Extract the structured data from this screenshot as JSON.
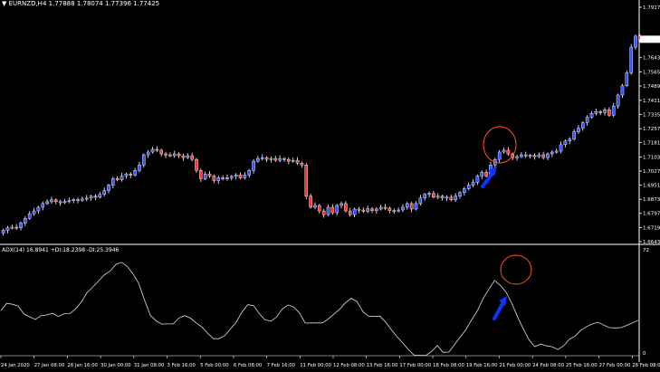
{
  "window": {
    "symbol_label": "EURNZD,H4",
    "ohlc": "1.77888 1.78074 1.77396 1.77425",
    "indicator_label": "ADX(14) 16.8941 +DI:18.2398 -DI:25.3946"
  },
  "colors": {
    "background": "#000000",
    "bull": "#3355ff",
    "bear": "#ff3333",
    "wick": "#ffffff",
    "axis": "#ffffff",
    "annotation_circle": "#ff5522",
    "arrow": "#1133ff"
  },
  "chart_data": [
    {
      "type": "candlestick",
      "title": "EURNZD,H4",
      "ylim": [
        1.6643,
        1.7917
      ],
      "y_ticks": [
        "1.79170",
        "1.76430",
        "1.75650",
        "1.74890",
        "1.74110",
        "1.73350",
        "1.72570",
        "1.71810",
        "1.71030",
        "1.70270",
        "1.69510",
        "1.68730",
        "1.67970",
        "1.67190",
        "1.66430"
      ],
      "x_ticks": [
        "24 Jan 2020",
        "27 Jan 08:00",
        "28 Jan 16:00",
        "30 Jan 00:00",
        "31 Jan 08:00",
        "3 Feb 16:00",
        "5 Feb 00:00",
        "6 Feb 08:00",
        "7 Feb 16:00",
        "11 Feb 00:00",
        "12 Feb 08:00",
        "13 Feb 16:00",
        "17 Feb 00:00",
        "18 Feb 08:00",
        "19 Feb 16:00",
        "21 Feb 00:00",
        "24 Feb 08:00",
        "25 Feb 16:00",
        "27 Feb 00:00",
        "28 Feb 08:00"
      ],
      "close": [
        1.6705,
        1.6718,
        1.6722,
        1.6718,
        1.6745,
        1.677,
        1.6795,
        1.681,
        1.683,
        1.685,
        1.686,
        1.687,
        1.686,
        1.6855,
        1.6862,
        1.6866,
        1.6872,
        1.6868,
        1.6875,
        1.688,
        1.689,
        1.6885,
        1.69,
        1.692,
        1.695,
        1.6985,
        1.698,
        1.7,
        1.701,
        1.7005,
        1.703,
        1.706,
        1.7115,
        1.713,
        1.7145,
        1.714,
        1.712,
        1.7115,
        1.711,
        1.712,
        1.711,
        1.71,
        1.711,
        1.709,
        1.703,
        1.6985,
        1.701,
        1.7,
        1.6975,
        1.699,
        1.6985,
        1.699,
        1.6998,
        1.7005,
        1.699,
        1.7005,
        1.703,
        1.708,
        1.7095,
        1.71,
        1.709,
        1.7095,
        1.7085,
        1.7095,
        1.709,
        1.708,
        1.7085,
        1.707,
        1.706,
        1.689,
        1.683,
        1.684,
        1.681,
        1.679,
        1.683,
        1.68,
        1.684,
        1.685,
        1.681,
        1.679,
        1.682,
        1.6815,
        1.6808,
        1.6822,
        1.6812,
        1.682,
        1.683,
        1.6825,
        1.6812,
        1.681,
        1.6815,
        1.683,
        1.685,
        1.682,
        1.685,
        1.688,
        1.69,
        1.6905,
        1.6885,
        1.689,
        1.688,
        1.6885,
        1.687,
        1.689,
        1.691,
        1.693,
        1.695,
        1.6965,
        1.7,
        1.702,
        1.7,
        1.706,
        1.709,
        1.713,
        1.714,
        1.712,
        1.71,
        1.7105,
        1.7115,
        1.711,
        1.7112,
        1.7105,
        1.7115,
        1.71,
        1.712,
        1.713,
        1.7135,
        1.717,
        1.719,
        1.72,
        1.724,
        1.726,
        1.729,
        1.732,
        1.734,
        1.735,
        1.7345,
        1.736,
        1.733,
        1.738,
        1.744,
        1.749,
        1.756,
        1.77,
        1.776,
        1.7743
      ]
    },
    {
      "type": "line",
      "title": "ADX(14) 16.8941 +DI:18.2398 -DI:25.3946",
      "series": [
        {
          "name": "ADX(14)",
          "values": [
            24.9,
            31.3,
            30.4,
            29.0,
            22.2,
            19.8,
            17.5,
            20.8,
            21.3,
            22.8,
            20.0,
            22.4,
            22.5,
            26.5,
            32.3,
            40.3,
            45.2,
            50.3,
            55.6,
            58.7,
            64.4,
            66.3,
            62.8,
            56.4,
            48.3,
            34.1,
            21.3,
            16.4,
            13.5,
            13.7,
            13.7,
            18.7,
            20.8,
            18.7,
            14.6,
            11.1,
            5.9,
            1.1,
            1.1,
            3.8,
            9.6,
            15.2,
            24.0,
            30.1,
            29.3,
            22.5,
            17.2,
            15.9,
            19.5,
            26.4,
            29.9,
            28.1,
            23.0,
            14.4,
            14.5,
            14.5,
            14.6,
            17.9,
            22.0,
            26.3,
            31.7,
            35.6,
            32.8,
            24.4,
            20.4,
            20.0,
            20.3,
            15.3,
            8.8,
            2.7,
            -2.6,
            -8.4,
            -13.1,
            -13.1,
            -13.3,
            -9.8,
            -4.7,
            -10.6,
            -10.4,
            -4.0,
            2.6,
            8.9,
            17.4,
            25.0,
            35.7,
            43.5,
            50.8,
            46.5,
            40.6,
            31.0,
            19.5,
            9.1,
            -0.2,
            -5.7,
            -3.5,
            -5.0,
            -5.8,
            -8.2,
            -5.0,
            0.6,
            3.2,
            8.3,
            11.4,
            13.7,
            15.1,
            12.6,
            10.5,
            10.3,
            10.5,
            12.4,
            14.5,
            16.8
          ]
        }
      ]
    }
  ]
}
